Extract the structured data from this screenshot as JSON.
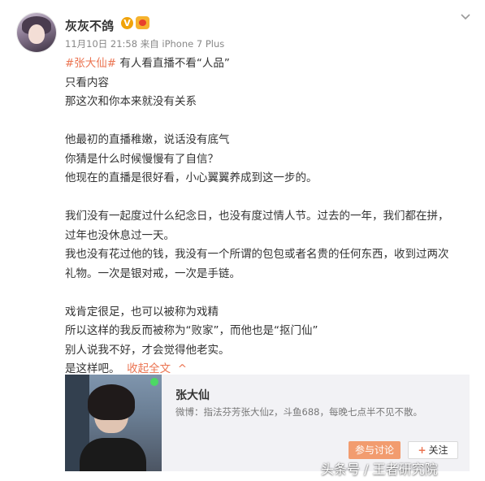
{
  "post": {
    "user_name": "灰灰不鸽",
    "verified_badge": "V",
    "meta": "11月10日 21:58 来自 iPhone 7 Plus",
    "hashtag": "#张大仙#",
    "lines": [
      " 有人看直播不看“人品”",
      "只看内容",
      "那这次和你本来就没有关系",
      "",
      "他最初的直播稚嫩，说话没有底气",
      "你猜是什么时候慢慢有了自信？",
      "他现在的直播是很好看，小心翼翼养成到这一步的。",
      "",
      "我们没有一起度过什么纪念日，也没有度过情人节。过去的一年，我们都在拼，",
      "过年也没休息过一天。",
      "我也没有花过他的钱，我没有一个所谓的包包或者名贵的任何东西，收到过两次",
      "礼物。一次是银对戒，一次是手链。",
      "",
      "戏肯定很足，也可以被称为戏精",
      "所以这样的我反而被称为“败家”，而他也是“抠门仙”",
      "别人说我不好，才会觉得他老实。"
    ],
    "last_line": "是这样吧。",
    "collapse_label": "收起全文",
    "collapse_icon": "^"
  },
  "card": {
    "title": "张大仙",
    "description": "微博：指法芬芳张大仙z，斗鱼688，每晚七点半不见不散。",
    "join_label": "参与讨论",
    "follow_plus": "+",
    "follow_label": "关注"
  },
  "watermark": "头条号 / 王者研究院",
  "colors": {
    "accent": "#eb7350",
    "join_button": "#f29c6f",
    "verified": "#f0a30a"
  }
}
